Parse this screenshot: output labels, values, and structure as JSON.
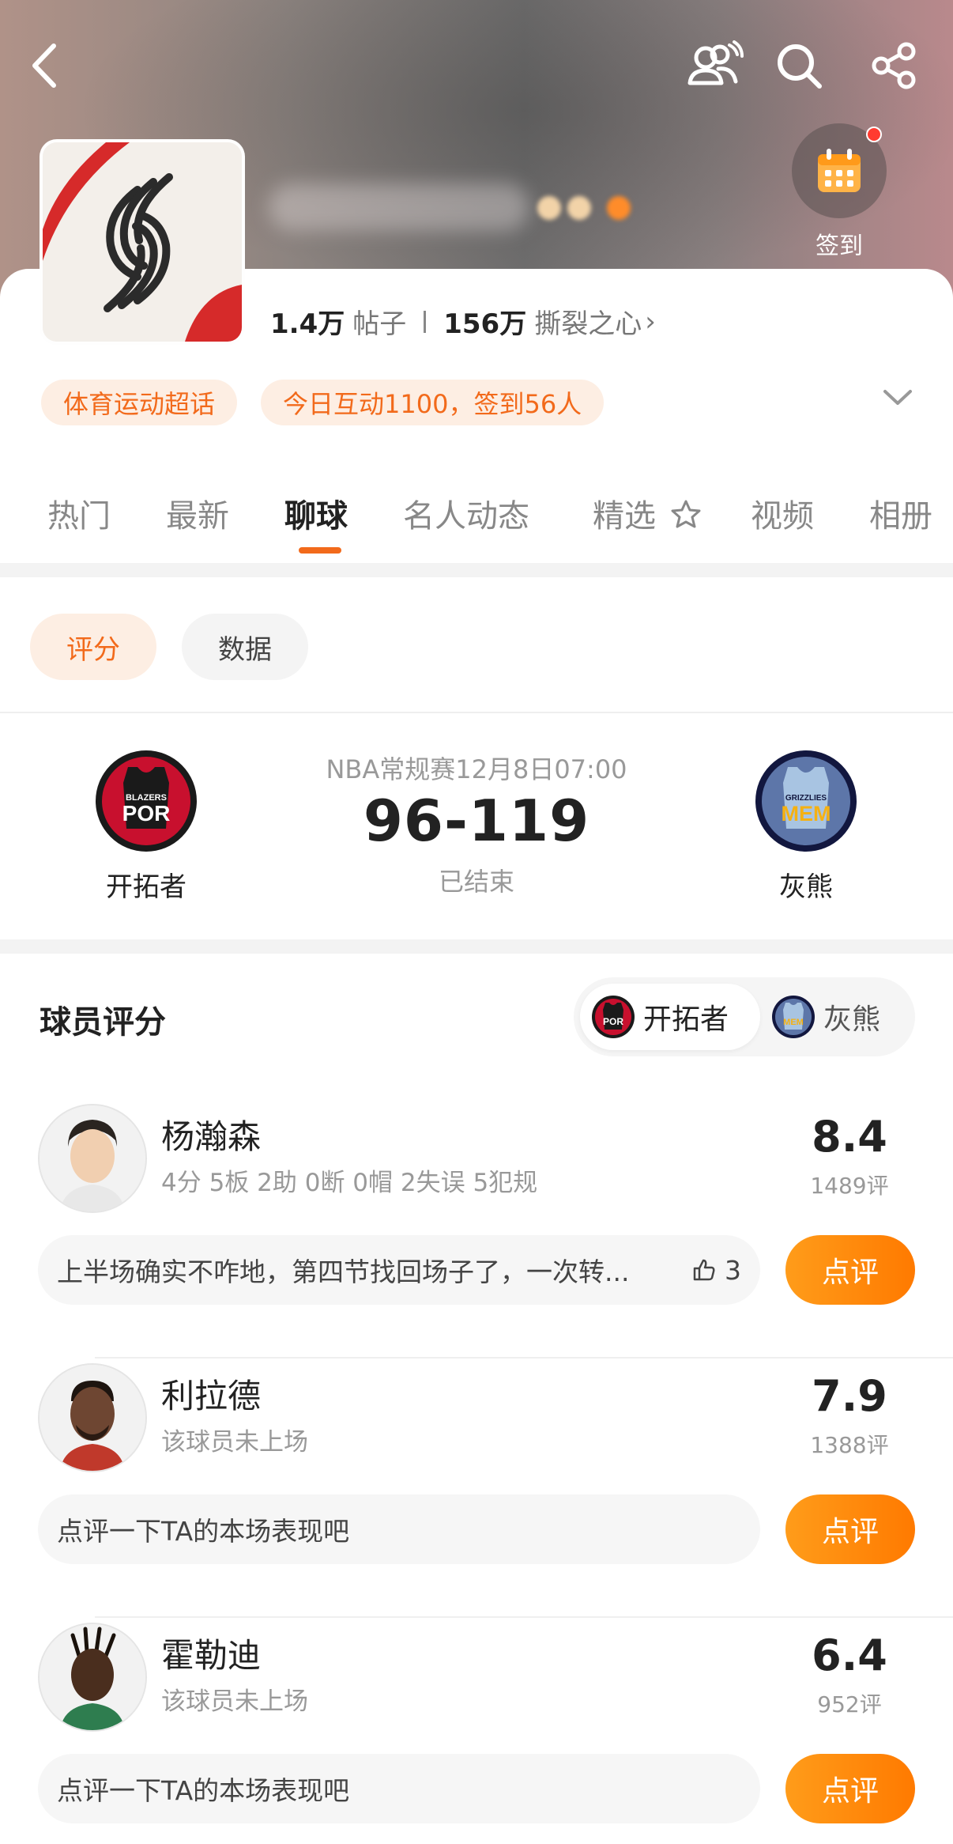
{
  "header": {
    "checkin_label": "签到"
  },
  "community": {
    "posts_count": "1.4万",
    "posts_label": "帖子",
    "fans_count": "156万",
    "fans_label": "撕裂之心",
    "fans_arrow": "›",
    "chips": [
      "体育运动超话",
      "今日互动1100，签到56人"
    ]
  },
  "tabs": [
    "热门",
    "最新",
    "聊球",
    "名人动态",
    "精选",
    "视频",
    "相册"
  ],
  "active_tab": "聊球",
  "segments": {
    "active": "评分",
    "inactive": "数据"
  },
  "match": {
    "info": "NBA常规赛12月8日07:00",
    "score": "96-119",
    "status": "已结束",
    "home": {
      "name": "开拓者",
      "logo_text": "POR",
      "logo_sub": "BLAZERS"
    },
    "away": {
      "name": "灰熊",
      "logo_text": "MEM",
      "logo_sub": "GRIZZLIES"
    }
  },
  "ratings": {
    "title": "球员评分",
    "toggle_active": "开拓者",
    "toggle_inactive": "灰熊",
    "review_button": "点评",
    "players": [
      {
        "name": "杨瀚森",
        "stats": "4分 5板 2助 0断 0帽 2失误 5犯规",
        "score": "8.4",
        "count": "1489评",
        "comment": "上半场确实不咋地，第四节找回场子了，一次转...",
        "likes": "3"
      },
      {
        "name": "利拉德",
        "stats": "该球员未上场",
        "score": "7.9",
        "count": "1388评",
        "comment": "点评一下TA的本场表现吧",
        "likes": ""
      },
      {
        "name": "霍勒迪",
        "stats": "该球员未上场",
        "score": "6.4",
        "count": "952评",
        "comment": "点评一下TA的本场表现吧",
        "likes": ""
      }
    ]
  },
  "colors": {
    "accent": "#f26a1b",
    "button": "#ff8a0d",
    "blazers_red": "#c8102e",
    "grizzlies_blue": "#5d76a9"
  }
}
